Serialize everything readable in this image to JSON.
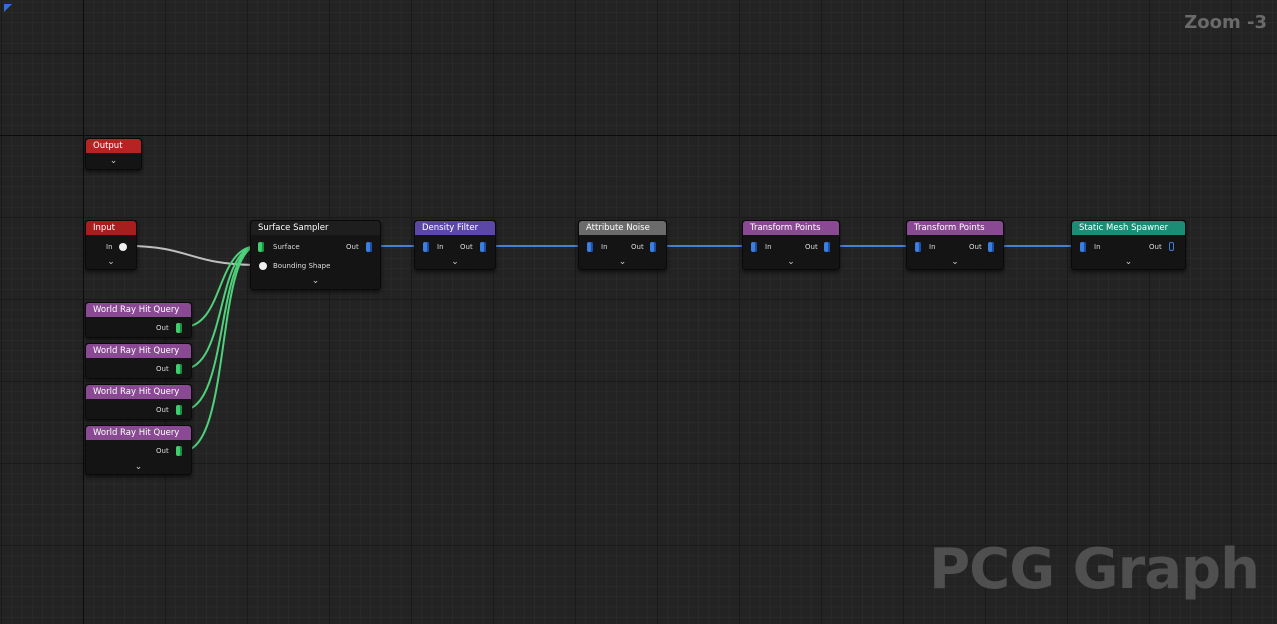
{
  "zoom_label": "Zoom -3",
  "watermark": "PCG Graph",
  "colors": {
    "wire_point": "#4a7fd6",
    "wire_spatial": "#4ed17a",
    "wire_shape": "#bfbfbf",
    "header_output": "#b52323",
    "header_input": "#a61e1e",
    "header_query": "#8a4a93",
    "header_surface": "#1e1e1e",
    "header_filter": "#5b48a6",
    "header_noise": "#6b6b6b",
    "header_transform": "#8a4a93",
    "header_spawner": "#1c8c77"
  },
  "icons": {
    "collapse": "chevron-down-icon",
    "point_pin": "point-data-pin-icon",
    "spatial_pin": "spatial-data-pin-icon"
  },
  "nodes": {
    "output": {
      "title": "Output"
    },
    "input": {
      "title": "Input",
      "in_label": "In"
    },
    "query_1": {
      "title": "World Ray Hit Query",
      "out_label": "Out"
    },
    "query_2": {
      "title": "World Ray Hit Query",
      "out_label": "Out"
    },
    "query_3": {
      "title": "World Ray Hit Query",
      "out_label": "Out"
    },
    "query_4": {
      "title": "World Ray Hit Query",
      "out_label": "Out"
    },
    "surface_sampler": {
      "title": "Surface Sampler",
      "surface_label": "Surface",
      "shape_label": "Bounding Shape",
      "out_label": "Out"
    },
    "density_filter": {
      "title": "Density Filter",
      "in_label": "In",
      "out_label": "Out"
    },
    "attribute_noise": {
      "title": "Attribute Noise",
      "in_label": "In",
      "out_label": "Out"
    },
    "transform_1": {
      "title": "Transform Points",
      "in_label": "In",
      "out_label": "Out"
    },
    "transform_2": {
      "title": "Transform Points",
      "in_label": "In",
      "out_label": "Out"
    },
    "static_mesh_spawner": {
      "title": "Static Mesh Spawner",
      "in_label": "In",
      "out_label": "Out"
    }
  }
}
